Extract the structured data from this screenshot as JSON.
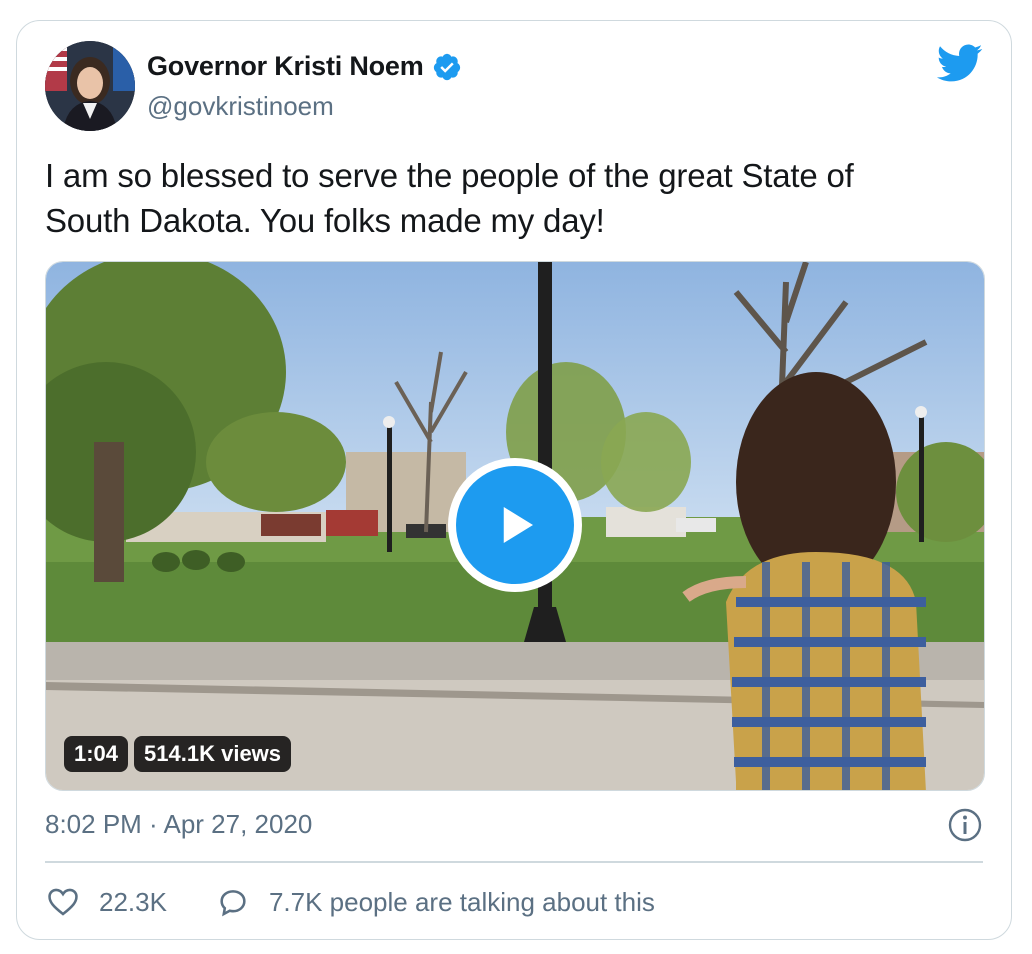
{
  "tweet": {
    "author": {
      "display_name": "Governor Kristi Noem",
      "handle": "@govkristinoem",
      "verified": true
    },
    "text": "I am so blessed to serve the people of the great State of South Dakota. You folks made my day!",
    "media": {
      "type": "video",
      "duration": "1:04",
      "views": "514.1K views"
    },
    "timestamp": "8:02 PM · Apr 27, 2020",
    "likes": "22.3K",
    "talking": "7.7K people are talking about this"
  },
  "icons": {
    "brand": "twitter-bird-icon",
    "verified": "verified-badge-icon",
    "like": "heart-icon",
    "reply": "speech-bubble-icon",
    "info": "info-icon",
    "play": "play-icon"
  },
  "colors": {
    "accent": "#1d9bf0",
    "text": "#14171a",
    "secondary": "#5b7083",
    "border": "#cfd9de"
  }
}
